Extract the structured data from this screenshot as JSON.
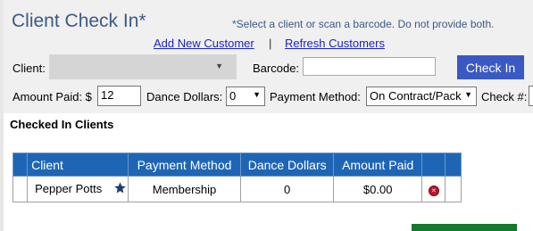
{
  "header": {
    "title": "Client Check In*",
    "note": "*Select a client or scan a barcode. Do not provide both.",
    "add_customer": "Add New Customer",
    "separator": "|",
    "refresh_customers": "Refresh Customers"
  },
  "form": {
    "client_label": "Client:",
    "barcode_label": "Barcode:",
    "checkin_button": "Check In",
    "amount_paid_label": "Amount Paid: $",
    "amount_paid_value": "12",
    "dance_dollars_label": "Dance Dollars:",
    "dance_dollars_value": "0",
    "payment_method_label": "Payment Method:",
    "payment_method_value": "On Contract/Pack",
    "check_number_label": "Check #:"
  },
  "checked_in": {
    "title": "Checked In Clients",
    "columns": [
      "Client",
      "Payment Method",
      "Dance Dollars",
      "Amount Paid",
      "",
      ""
    ],
    "rows": [
      {
        "client": "Pepper Potts",
        "payment_method": "Membership",
        "dance_dollars": "0",
        "amount_paid": "$0.00"
      }
    ]
  },
  "colors": {
    "accent": "#3b59c3",
    "header_blue": "#1e66b5",
    "title_blue": "#3b5a86",
    "remove_red": "#c0172b",
    "footer_green": "#137a2e"
  },
  "icons": {
    "favorite": "star-icon",
    "remove": "remove-icon",
    "dropdown": "chevron-down-icon"
  }
}
